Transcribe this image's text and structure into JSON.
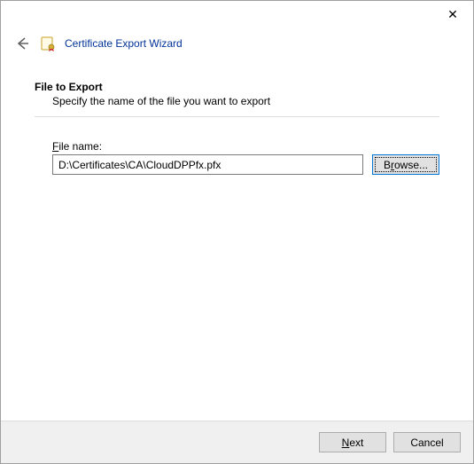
{
  "titlebar": {
    "close_glyph": "✕"
  },
  "header": {
    "wizard_title": "Certificate Export Wizard"
  },
  "page": {
    "heading": "File to Export",
    "subheading": "Specify the name of the file you want to export"
  },
  "filename": {
    "label": "File name:",
    "value": "D:\\Certificates\\CA\\CloudDPPfx.pfx"
  },
  "buttons": {
    "browse": "Browse...",
    "next": "Next",
    "cancel": "Cancel"
  }
}
